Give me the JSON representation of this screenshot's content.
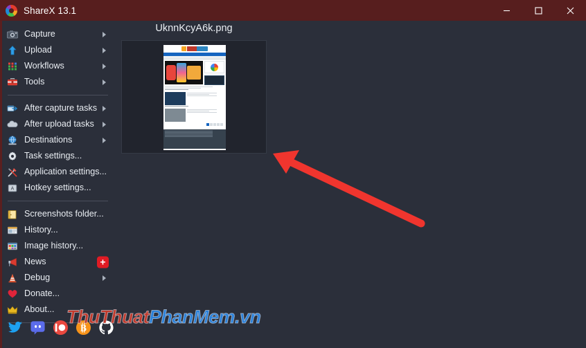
{
  "window": {
    "title": "ShareX 13.1",
    "logo_icon": "sharex-logo-icon",
    "titlebar_color": "#571e1e",
    "background_color": "#2b2f3a",
    "controls": [
      {
        "name": "minimize",
        "glyph": "minimize-icon"
      },
      {
        "name": "maximize",
        "glyph": "maximize-icon"
      },
      {
        "name": "close",
        "glyph": "close-icon"
      }
    ]
  },
  "sidebar": {
    "groups": [
      {
        "items": [
          {
            "label": "Capture",
            "icon": "camera-icon",
            "submenu": true
          },
          {
            "label": "Upload",
            "icon": "upload-arrow-icon",
            "submenu": true
          },
          {
            "label": "Workflows",
            "icon": "grid-icon",
            "submenu": true
          },
          {
            "label": "Tools",
            "icon": "toolbox-icon",
            "submenu": true
          }
        ]
      },
      {
        "items": [
          {
            "label": "After capture tasks",
            "icon": "after-capture-icon",
            "submenu": true
          },
          {
            "label": "After upload tasks",
            "icon": "cloud-icon",
            "submenu": true
          },
          {
            "label": "Destinations",
            "icon": "globe-icon",
            "submenu": true
          },
          {
            "label": "Task settings...",
            "icon": "gear-icon",
            "submenu": false
          },
          {
            "label": "Application settings...",
            "icon": "tools-cross-icon",
            "submenu": false
          },
          {
            "label": "Hotkey settings...",
            "icon": "keyboard-key-icon",
            "submenu": false
          }
        ]
      },
      {
        "items": [
          {
            "label": "Screenshots folder...",
            "icon": "folder-icon",
            "submenu": false
          },
          {
            "label": "History...",
            "icon": "history-icon",
            "submenu": false
          },
          {
            "label": "Image history...",
            "icon": "image-history-icon",
            "submenu": false
          },
          {
            "label": "News",
            "icon": "megaphone-icon",
            "submenu": false,
            "badge": "+"
          },
          {
            "label": "Debug",
            "icon": "traffic-cone-icon",
            "submenu": true
          },
          {
            "label": "Donate...",
            "icon": "heart-icon",
            "submenu": false
          },
          {
            "label": "About...",
            "icon": "crown-icon",
            "submenu": false
          }
        ]
      }
    ],
    "social": [
      {
        "name": "twitter-icon",
        "color": "#1da1f2"
      },
      {
        "name": "discord-icon",
        "color": "#5865f2"
      },
      {
        "name": "patreon-icon",
        "color": "#e9483f"
      },
      {
        "name": "bitcoin-icon",
        "color": "#f7931a"
      },
      {
        "name": "github-icon",
        "color": "#ffffff"
      }
    ],
    "badge_color": "#e01b24"
  },
  "main": {
    "filename": "UknnKcyA6k.png",
    "thumbnail_alt": "captured-webpage-screenshot"
  },
  "annotation": {
    "arrow_color": "#f0352e",
    "points_to": "thumbnail-panel"
  },
  "watermark": {
    "part1": "ThuThuat",
    "part2": "PhanMem.vn",
    "color1": "#c0392b",
    "color2": "#2980d9"
  }
}
